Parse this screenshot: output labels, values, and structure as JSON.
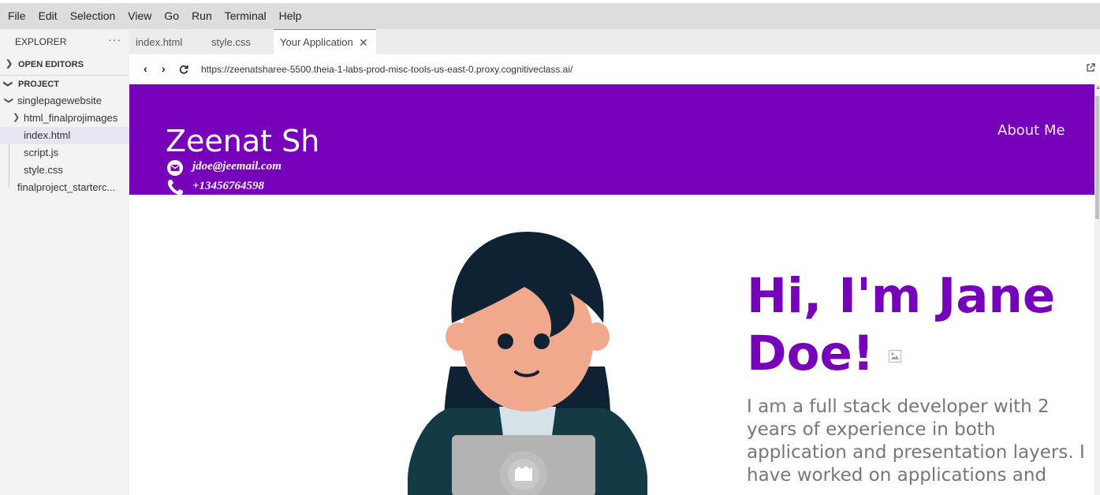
{
  "menu": [
    "File",
    "Edit",
    "Selection",
    "View",
    "Go",
    "Run",
    "Terminal",
    "Help"
  ],
  "explorer": {
    "title": "EXPLORER",
    "more": "···",
    "open_editors": "OPEN EDITORS",
    "project": "PROJECT",
    "tree": {
      "root": "singlepagewebsite",
      "folder": "html_finalprojimages",
      "files": [
        "index.html",
        "script.js",
        "style.css"
      ],
      "other": "finalproject_starterc..."
    }
  },
  "tabs": [
    {
      "label": "index.html",
      "active": false
    },
    {
      "label": "style.css",
      "active": false
    },
    {
      "label": "Your Application",
      "active": true
    }
  ],
  "browser": {
    "url": "https://zeenatsharee-5500.theia-1-labs-prod-misc-tools-us-east-0.proxy.cognitiveclass.ai/"
  },
  "site": {
    "header_bg": "#7700bb",
    "name": "Zeenat Sh",
    "email": "jdoe@jeemail.com",
    "phone": "+13456764598",
    "nav_link": "About Me",
    "hero_line1": "Hi, I'm Jane",
    "hero_line2": "Doe!",
    "description": "I am a full stack developer with 2 years of experience in both application and presentation layers. I have worked on applications and"
  },
  "icons": {
    "mail": "envelope-circle-icon",
    "phone": "phone-icon",
    "external": "open-external-icon"
  }
}
